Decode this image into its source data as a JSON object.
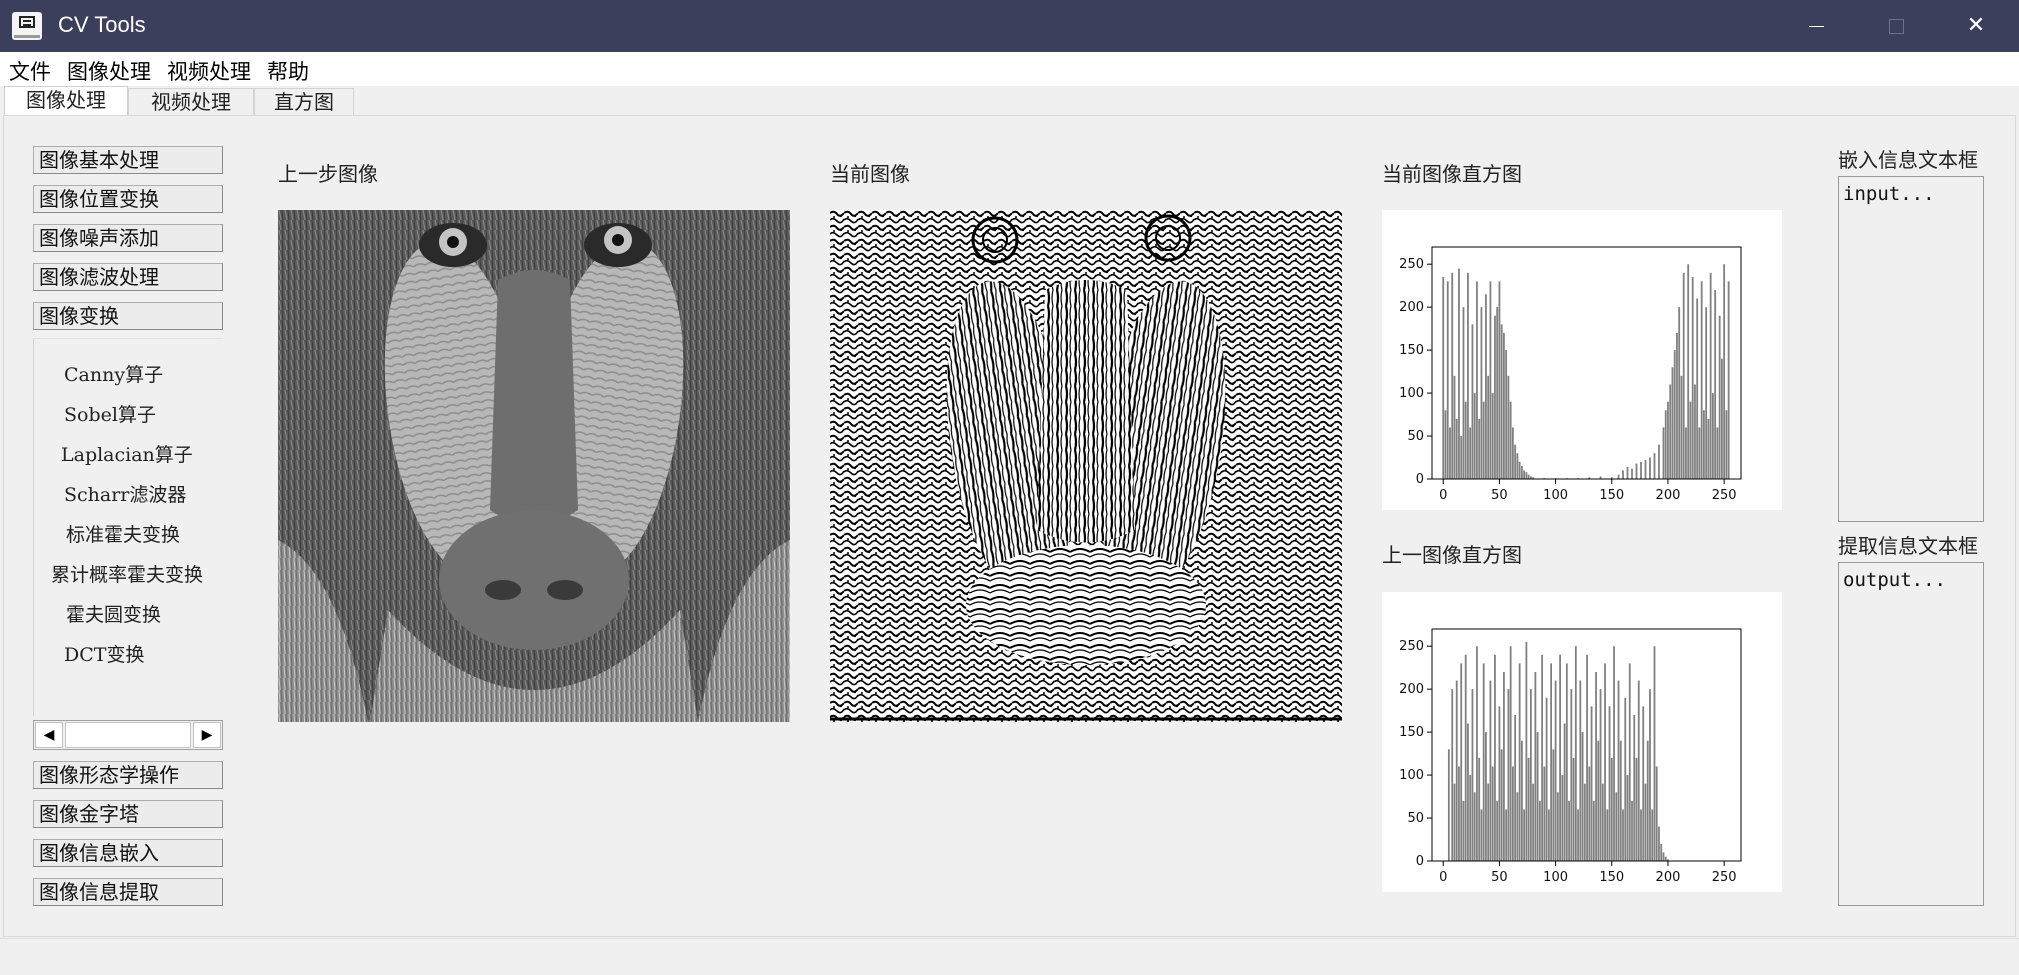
{
  "window": {
    "title": "CV Tools",
    "minimize": "—",
    "close": "✕"
  },
  "menu": [
    "文件",
    "图像处理",
    "视频处理",
    "帮助"
  ],
  "tabs": [
    "图像处理",
    "视频处理",
    "直方图"
  ],
  "toolbox": {
    "top_buttons": [
      "图像基本处理",
      "图像位置变换",
      "图像噪声添加",
      "图像滤波处理",
      "图像变换"
    ],
    "transform_items": [
      "Canny算子",
      "Sobel算子",
      "Laplacian算子",
      "Scharr滤波器",
      "标准霍夫变换",
      "累计概率霍夫变换",
      "霍夫圆变换",
      "DCT变换"
    ],
    "bottom_buttons": [
      "图像形态学操作",
      "图像金字塔",
      "图像信息嵌入",
      "图像信息提取"
    ],
    "scroll_left": "◀",
    "scroll_right": "▶"
  },
  "headings": {
    "prev_image": "上一步图像",
    "curr_image": "当前图像",
    "curr_hist": "当前图像直方图",
    "prev_hist": "上一图像直方图",
    "embed": "嵌入信息文本框",
    "extract": "提取信息文本框"
  },
  "textboxes": {
    "embed_placeholder": "input...",
    "extract_placeholder": "output..."
  },
  "chart_data": [
    {
      "type": "bar",
      "xlim": [
        -10,
        265
      ],
      "ylim": [
        0,
        270
      ],
      "x_ticks": [
        0,
        50,
        100,
        150,
        200,
        250
      ],
      "y_ticks": [
        0,
        50,
        100,
        150,
        200,
        250
      ],
      "color": "#808080",
      "series": [
        {
          "x": [
            0,
            2,
            4,
            6,
            8,
            10,
            12,
            14,
            16,
            18,
            20,
            22,
            24,
            26,
            28,
            30,
            32,
            34,
            36,
            38,
            40,
            42,
            44,
            46,
            48,
            50,
            52,
            54,
            56,
            58,
            60,
            62,
            64,
            66,
            68,
            70,
            72,
            74,
            76,
            78,
            80,
            90,
            100,
            110,
            120,
            130,
            140,
            150,
            156,
            160,
            164,
            168,
            172,
            176,
            180,
            184,
            188,
            192,
            196,
            198,
            200,
            202,
            204,
            206,
            208,
            210,
            212,
            214,
            216,
            218,
            220,
            222,
            224,
            226,
            228,
            230,
            232,
            234,
            236,
            238,
            240,
            242,
            244,
            246,
            248,
            250,
            252,
            254
          ],
          "y": [
            235,
            80,
            230,
            60,
            240,
            120,
            70,
            245,
            50,
            200,
            90,
            240,
            60,
            180,
            100,
            230,
            70,
            200,
            90,
            215,
            120,
            230,
            100,
            190,
            200,
            230,
            180,
            170,
            150,
            120,
            90,
            60,
            40,
            30,
            20,
            15,
            10,
            8,
            5,
            3,
            2,
            1,
            1,
            1,
            1,
            2,
            3,
            2,
            5,
            10,
            14,
            12,
            18,
            20,
            22,
            25,
            30,
            40,
            60,
            80,
            90,
            110,
            130,
            150,
            170,
            200,
            120,
            240,
            60,
            250,
            90,
            235,
            110,
            210,
            60,
            230,
            80,
            200,
            70,
            240,
            100,
            220,
            60,
            190,
            140,
            250,
            80,
            230
          ]
        }
      ]
    },
    {
      "type": "bar",
      "xlim": [
        -10,
        265
      ],
      "ylim": [
        0,
        270
      ],
      "x_ticks": [
        0,
        50,
        100,
        150,
        200,
        250
      ],
      "y_ticks": [
        0,
        50,
        100,
        150,
        200,
        250
      ],
      "color": "#808080",
      "series": [
        {
          "x": [
            5,
            8,
            10,
            12,
            14,
            16,
            18,
            20,
            22,
            24,
            26,
            28,
            30,
            32,
            34,
            36,
            38,
            40,
            42,
            44,
            46,
            48,
            50,
            52,
            54,
            56,
            58,
            60,
            62,
            64,
            66,
            68,
            70,
            72,
            74,
            76,
            78,
            80,
            82,
            84,
            86,
            88,
            90,
            92,
            94,
            96,
            98,
            100,
            102,
            104,
            106,
            108,
            110,
            112,
            114,
            116,
            118,
            120,
            122,
            124,
            126,
            128,
            130,
            132,
            134,
            136,
            138,
            140,
            142,
            144,
            146,
            148,
            150,
            152,
            154,
            156,
            158,
            160,
            162,
            164,
            166,
            168,
            170,
            172,
            174,
            176,
            178,
            180,
            182,
            184,
            186,
            188,
            190,
            192,
            194,
            196,
            198,
            200
          ],
          "y": [
            130,
            200,
            90,
            210,
            110,
            230,
            70,
            240,
            160,
            100,
            200,
            80,
            250,
            120,
            60,
            230,
            150,
            90,
            210,
            110,
            240,
            70,
            180,
            130,
            220,
            60,
            200,
            250,
            110,
            170,
            80,
            230,
            140,
            60,
            255,
            120,
            200,
            90,
            220,
            150,
            70,
            240,
            110,
            190,
            60,
            230,
            130,
            210,
            80,
            240,
            100,
            160,
            230,
            70,
            200,
            120,
            250,
            60,
            210,
            150,
            90,
            240,
            110,
            180,
            70,
            220,
            140,
            200,
            90,
            230,
            60,
            180,
            120,
            250,
            80,
            210,
            140,
            60,
            190,
            100,
            230,
            70,
            170,
            120,
            210,
            60,
            180,
            90,
            140,
            200,
            60,
            250,
            110,
            40,
            20,
            10,
            5,
            2
          ]
        }
      ]
    }
  ]
}
